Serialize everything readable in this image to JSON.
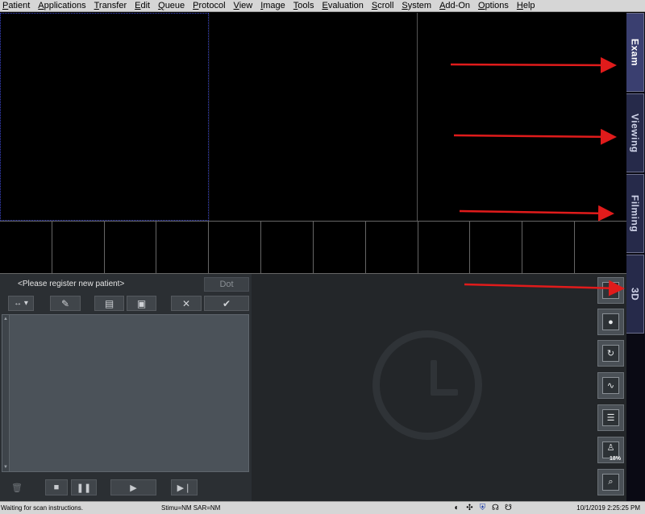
{
  "menu": [
    {
      "label": "Patient",
      "underline": "P",
      "rest": "atient"
    },
    {
      "label": "Applications",
      "underline": "A",
      "rest": "pplications"
    },
    {
      "label": "Transfer",
      "underline": "T",
      "rest": "ransfer"
    },
    {
      "label": "Edit",
      "underline": "E",
      "rest": "dit"
    },
    {
      "label": "Queue",
      "underline": "Q",
      "rest": "ueue"
    },
    {
      "label": "Protocol",
      "underline": "P",
      "rest": "rotocol"
    },
    {
      "label": "View",
      "underline": "V",
      "rest": "iew"
    },
    {
      "label": "Image",
      "underline": "I",
      "rest": "mage"
    },
    {
      "label": "Tools",
      "underline": "T",
      "rest": "ools"
    },
    {
      "label": "Evaluation",
      "underline": "E",
      "rest": "valuation"
    },
    {
      "label": "Scroll",
      "underline": "S",
      "rest": "croll"
    },
    {
      "label": "System",
      "underline": "S",
      "rest": "ystem"
    },
    {
      "label": "Add-On",
      "underline": "A",
      "rest": "dd-On"
    },
    {
      "label": "Options",
      "underline": "O",
      "rest": "ptions"
    },
    {
      "label": "Help",
      "underline": "H",
      "rest": "elp"
    }
  ],
  "side_tabs": [
    "Exam",
    "Viewing",
    "Filming",
    "3D"
  ],
  "active_tab": "Exam",
  "panel": {
    "patient_label": "<Please register new patient>",
    "dot_label": "Dot",
    "zoom_percent": "18%"
  },
  "status": {
    "left": "Waiting for scan instructions.",
    "mid": "Stimu=NM SAR=NM",
    "time": "10/1/2019 2:25:25 PM"
  },
  "colors": {
    "annotation_arrow": "#e01b1b",
    "tab_active": "#3a3f70"
  }
}
